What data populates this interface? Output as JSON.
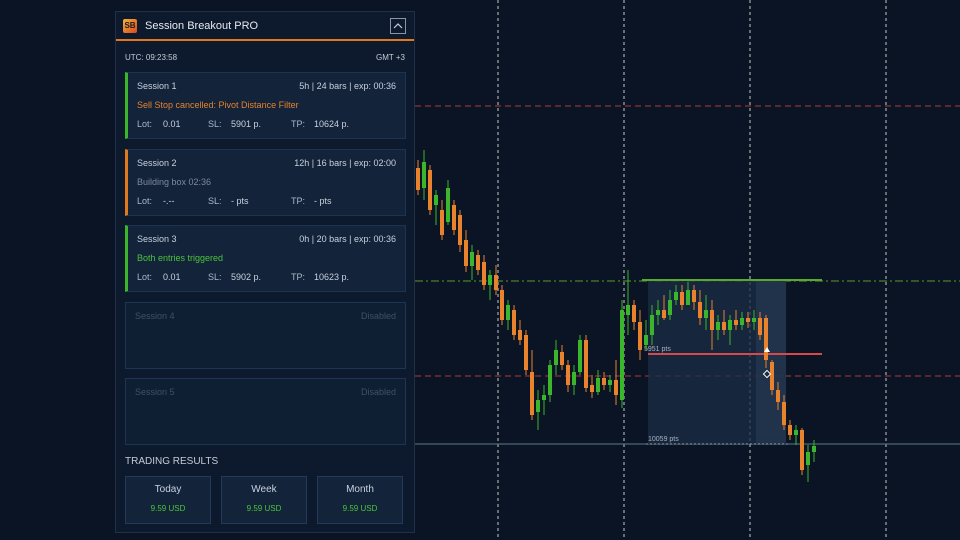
{
  "panel": {
    "logo_text": "SB",
    "title": "Session Breakout PRO",
    "utc_time": "UTC: 09:23:58",
    "gmt": "GMT +3"
  },
  "sessions": [
    {
      "name": "Session 1",
      "info": "5h | 24 bars | exp: 00:36",
      "status": "Sell Stop cancelled: Pivot Distance Filter",
      "lot_label": "Lot:",
      "lot": "0.01",
      "sl_label": "SL:",
      "sl": "5901 p.",
      "tp_label": "TP:",
      "tp": "10624 p."
    },
    {
      "name": "Session 2",
      "info": "12h | 16 bars | exp: 02:00",
      "status": "Building box 02:36",
      "lot_label": "Lot:",
      "lot": "-.--",
      "sl_label": "SL:",
      "sl": "- pts",
      "tp_label": "TP:",
      "tp": "- pts"
    },
    {
      "name": "Session 3",
      "info": "0h | 20 bars | exp: 00:36",
      "status": "Both entries triggered",
      "lot_label": "Lot:",
      "lot": "0.01",
      "sl_label": "SL:",
      "sl": "5902 p.",
      "tp_label": "TP:",
      "tp": "10623 p."
    },
    {
      "name": "Session 4",
      "info": "Disabled"
    },
    {
      "name": "Session 5",
      "info": "Disabled"
    }
  ],
  "results": {
    "title": "TRADING RESULTS",
    "cards": [
      {
        "label": "Today",
        "value": "9.59 USD"
      },
      {
        "label": "Week",
        "value": "9.59 USD"
      },
      {
        "label": "Month",
        "value": "9.59 USD"
      }
    ]
  },
  "chart_labels": {
    "box_low_pts": "5951 pts",
    "target_pts": "10059 pts"
  },
  "colors": {
    "accent": "#e0781e",
    "bull": "#3bb62c",
    "bear": "#e8822c",
    "stop_line": "#d84a4a",
    "target_line": "#5aa832"
  },
  "candles": [
    [
      412,
      148,
      173,
      155,
      168
    ],
    [
      418,
      160,
      195,
      168,
      190
    ],
    [
      424,
      150,
      200,
      188,
      162
    ],
    [
      430,
      165,
      215,
      170,
      210
    ],
    [
      436,
      190,
      225,
      205,
      195
    ],
    [
      442,
      200,
      240,
      210,
      235
    ],
    [
      448,
      180,
      225,
      222,
      188
    ],
    [
      454,
      200,
      235,
      205,
      230
    ],
    [
      460,
      210,
      252,
      215,
      245
    ],
    [
      466,
      230,
      272,
      240,
      266
    ],
    [
      472,
      245,
      280,
      266,
      252
    ],
    [
      478,
      250,
      275,
      255,
      270
    ],
    [
      484,
      255,
      290,
      262,
      285
    ],
    [
      490,
      270,
      300,
      285,
      275
    ],
    [
      496,
      265,
      295,
      275,
      290
    ],
    [
      502,
      285,
      325,
      290,
      320
    ],
    [
      508,
      300,
      330,
      320,
      305
    ],
    [
      514,
      305,
      340,
      310,
      335
    ],
    [
      520,
      320,
      345,
      330,
      340
    ],
    [
      526,
      330,
      375,
      335,
      370
    ],
    [
      532,
      350,
      420,
      372,
      415
    ],
    [
      538,
      390,
      430,
      412,
      400
    ],
    [
      544,
      385,
      415,
      400,
      395
    ],
    [
      550,
      360,
      402,
      395,
      365
    ],
    [
      556,
      340,
      375,
      365,
      350
    ],
    [
      562,
      345,
      370,
      352,
      365
    ],
    [
      568,
      360,
      392,
      365,
      385
    ],
    [
      574,
      365,
      395,
      385,
      372
    ],
    [
      580,
      335,
      375,
      372,
      340
    ],
    [
      586,
      335,
      392,
      340,
      388
    ],
    [
      592,
      375,
      398,
      385,
      392
    ],
    [
      598,
      370,
      395,
      392,
      378
    ],
    [
      604,
      372,
      390,
      378,
      385
    ],
    [
      610,
      375,
      392,
      385,
      380
    ],
    [
      616,
      360,
      405,
      380,
      395
    ],
    [
      622,
      300,
      408,
      400,
      310
    ],
    [
      628,
      270,
      335,
      315,
      305
    ],
    [
      634,
      300,
      330,
      305,
      322
    ],
    [
      640,
      310,
      360,
      322,
      350
    ],
    [
      646,
      320,
      350,
      345,
      335
    ],
    [
      652,
      305,
      345,
      335,
      315
    ],
    [
      658,
      300,
      325,
      315,
      310
    ],
    [
      664,
      295,
      320,
      310,
      318
    ],
    [
      670,
      290,
      320,
      315,
      300
    ],
    [
      676,
      285,
      305,
      300,
      292
    ],
    [
      682,
      285,
      310,
      292,
      305
    ],
    [
      688,
      282,
      302,
      305,
      290
    ],
    [
      694,
      285,
      310,
      290,
      302
    ],
    [
      700,
      290,
      325,
      302,
      318
    ],
    [
      706,
      295,
      330,
      318,
      310
    ],
    [
      712,
      300,
      350,
      310,
      330
    ],
    [
      718,
      315,
      340,
      330,
      322
    ],
    [
      724,
      310,
      335,
      322,
      330
    ],
    [
      730,
      315,
      345,
      330,
      320
    ],
    [
      736,
      310,
      330,
      320,
      325
    ],
    [
      742,
      312,
      330,
      325,
      318
    ],
    [
      748,
      312,
      328,
      318,
      322
    ],
    [
      754,
      310,
      330,
      322,
      318
    ],
    [
      760,
      312,
      340,
      318,
      335
    ],
    [
      766,
      315,
      368,
      318,
      360
    ],
    [
      772,
      360,
      395,
      362,
      390
    ],
    [
      778,
      382,
      410,
      390,
      402
    ],
    [
      784,
      395,
      430,
      402,
      425
    ],
    [
      790,
      420,
      440,
      425,
      435
    ],
    [
      796,
      425,
      445,
      435,
      430
    ],
    [
      802,
      428,
      475,
      430,
      470
    ],
    [
      808,
      445,
      482,
      465,
      452
    ],
    [
      814,
      440,
      462,
      452,
      446
    ]
  ]
}
